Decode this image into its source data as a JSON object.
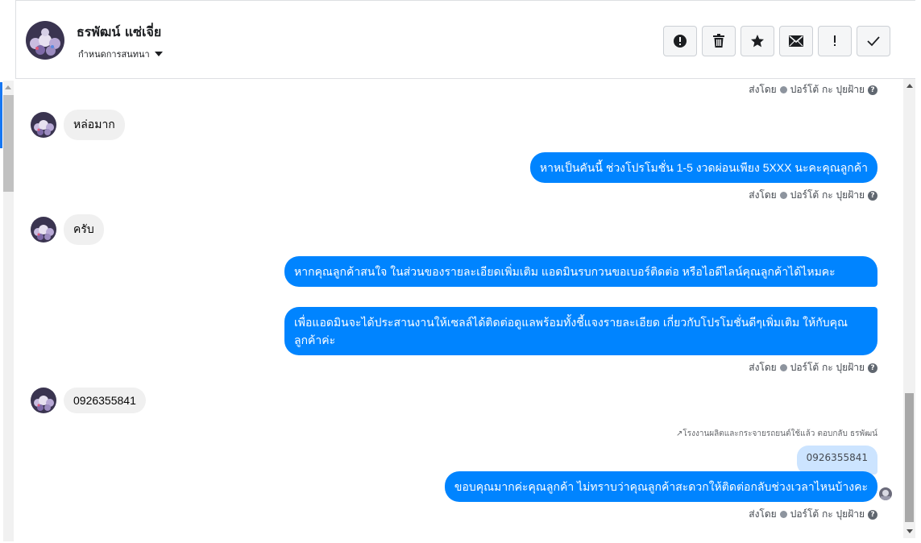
{
  "header": {
    "contact_name": "ธรพัฒน์ แซ่เจี่ย",
    "conversation_label": "กำหนดการสนทนา"
  },
  "actions": [
    {
      "name": "spam-button",
      "icon": "alert-circle-icon"
    },
    {
      "name": "delete-button",
      "icon": "trash-icon"
    },
    {
      "name": "star-button",
      "icon": "star-icon"
    },
    {
      "name": "mark-unread-button",
      "icon": "envelope-icon"
    },
    {
      "name": "important-button",
      "icon": "exclamation-icon"
    },
    {
      "name": "done-button",
      "icon": "checkmark-icon"
    }
  ],
  "sent_by": {
    "prefix": "ส่งโดย",
    "sender": "ปอร์โต้ กะ ปุยฝ้าย",
    "help": "?"
  },
  "messages": {
    "m1_in": "หล่อมาก",
    "m2_out": "หาหเป็นคันนี้ ช่วงโปรโมชั่น 1-5 งวดผ่อนเพียง 5XXX นะคะคุณลูกค้า",
    "m3_in": "ครับ",
    "m4_out_a": "หากคุณลูกค้าสนใจ ในส่วนของรายละเอียดเพิ่มเติม แอดมินรบกวนขอเบอร์ติดต่อ หรือไอดีไลน์คุณลูกค้าได้ไหมคะ",
    "m4_out_b": "เพื่อแอดมินจะได้ประสานงานให้เซลล์ได้ติดต่อดูแลพร้อมทั้งชี้แจงรายละเอียด เกี่ยวกับโปรโมชั่นดีๆเพิ่มเติม ให้กับคุณลูกค้าค่ะ",
    "m5_in": "0926355841",
    "reply_note": "โรงงานผลิตและกระจายรถยนต์ใช้แล้ว ตอบกลับ ธรพัฒน์",
    "quoted": "0926355841",
    "m6_out": "ขอบคุณมากค่ะคุณลูกค้า ไม่ทราบว่าคุณลูกค้าสะดวกให้ติดต่อกลับช่วงเวลาไหนบ้างคะ"
  },
  "colors": {
    "outgoing": "#0084ff",
    "incoming": "#f0f0f0",
    "quoted": "#cce4ff"
  }
}
